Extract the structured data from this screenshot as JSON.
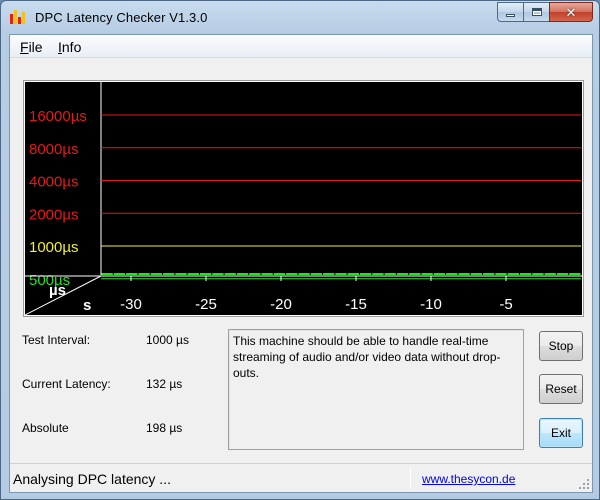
{
  "window": {
    "title": "DPC Latency Checker V1.3.0",
    "icon": "bar-chart-icon"
  },
  "menu": {
    "items": [
      {
        "label": "File",
        "accelerator": "F"
      },
      {
        "label": "Info",
        "accelerator": "I"
      }
    ]
  },
  "chart_data": {
    "type": "bar",
    "y_scale": "log2",
    "y_levels": [
      {
        "label": "16000µs",
        "value": 16000,
        "color": "#e31a1a"
      },
      {
        "label": "8000µs",
        "value": 8000,
        "color": "#e31a1a"
      },
      {
        "label": "4000µs",
        "value": 4000,
        "color": "#e31a1a"
      },
      {
        "label": "2000µs",
        "value": 2000,
        "color": "#e31a1a"
      },
      {
        "label": "1000µs",
        "value": 1000,
        "color": "#f2ee30"
      },
      {
        "label": "500µs",
        "value": 500,
        "color": "#27e027"
      }
    ],
    "x_ticks": [
      {
        "label": "-30",
        "value": -30
      },
      {
        "label": "-25",
        "value": -25
      },
      {
        "label": "-20",
        "value": -20
      },
      {
        "label": "-15",
        "value": -15
      },
      {
        "label": "-10",
        "value": -10
      },
      {
        "label": "-5",
        "value": -5
      }
    ],
    "corner_labels": {
      "y_unit": "µs",
      "x_unit": "s"
    },
    "x_range": [
      -32,
      0
    ],
    "bar_color": "#1ee61e",
    "values_us": [
      150,
      165,
      160,
      150,
      150,
      190,
      145,
      135,
      135,
      135,
      165,
      150,
      150,
      160,
      160,
      160,
      155,
      155,
      155,
      150,
      145,
      150,
      145,
      150,
      160,
      150,
      155,
      150,
      145,
      150,
      150,
      150,
      145,
      150,
      145,
      175,
      160,
      150,
      150
    ]
  },
  "info": {
    "test_interval_label": "Test Interval:",
    "test_interval_value": "1000 µs",
    "current_latency_label": "Current Latency:",
    "current_latency_value": "132 µs",
    "absolute_label": "Absolute",
    "absolute_value": "198 µs"
  },
  "message": "This machine should be able to handle real-time streaming of audio and/or video data without drop-outs.",
  "buttons": {
    "stop": "Stop",
    "reset": "Reset",
    "exit": "Exit"
  },
  "status": {
    "text": "Analysing DPC latency ...",
    "link": "www.thesycon.de"
  }
}
